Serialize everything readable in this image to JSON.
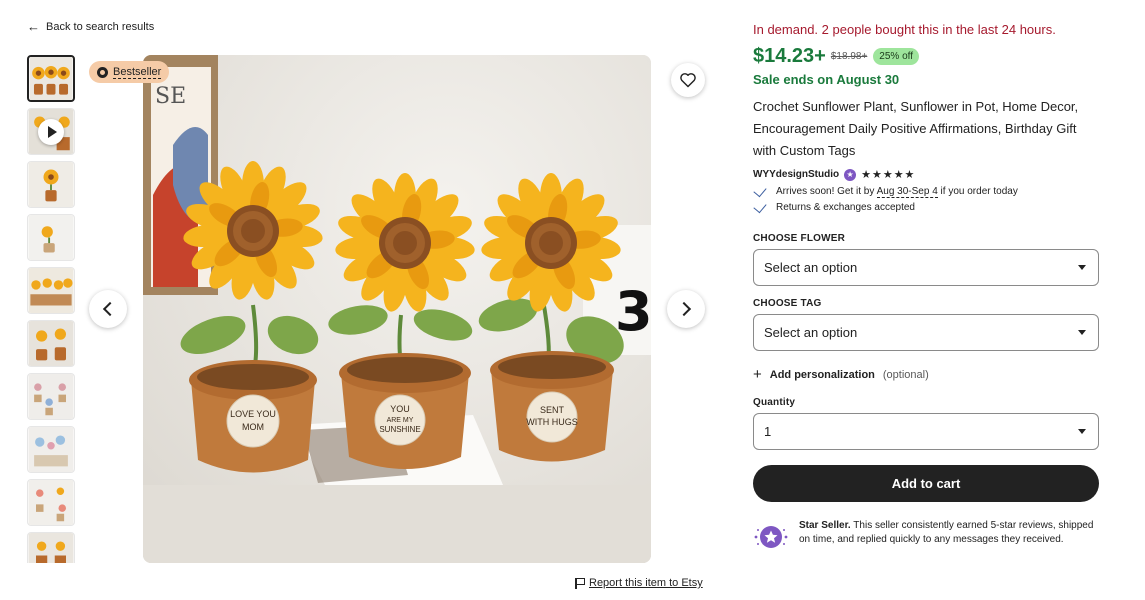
{
  "nav": {
    "back_label": "Back to search results",
    "back_icon": "arrow-left-icon"
  },
  "gallery": {
    "badge_label": "Bestseller",
    "thumb_count": 10,
    "report_label": "Report this item to Etsy"
  },
  "product": {
    "demand_text": "In demand. 2 people bought this in the last 24 hours.",
    "price": "$14.23+",
    "old_price": "$18.98+",
    "discount": "25% off",
    "sale_text": "Sale ends on August 30",
    "title": "Crochet Sunflower Plant, Sunflower in Pot, Home Decor, Encouragement Daily Positive Affirmations, Birthday Gift with Custom Tags",
    "shop_name": "WYYdesignStudio",
    "rating_stars": "★★★★★",
    "rating_value": 5,
    "arrival_prefix": "Arrives soon! Get it by ",
    "arrival_dates": "Aug 30-Sep 4",
    "arrival_suffix": " if you order today",
    "returns": "Returns & exchanges accepted"
  },
  "options": {
    "flower_label": "CHOOSE FLOWER",
    "flower_value": "Select an option",
    "tag_label": "CHOOSE TAG",
    "tag_value": "Select an option",
    "personalization_label": "Add personalization",
    "personalization_optional": "(optional)",
    "quantity_label": "Quantity",
    "quantity_value": "1",
    "add_to_cart": "Add to cart"
  },
  "star_seller": {
    "title": "Star Seller.",
    "text": " This seller consistently earned 5-star reviews, shipped on time, and replied quickly to any messages they received."
  },
  "image_text": {
    "tag1_line1": "LOVE YOU",
    "tag1_line2": "MOM",
    "tag2_line1": "YOU",
    "tag2_line2": "ARE MY",
    "tag2_line3": "SUNSHINE",
    "tag3_line1": "SENT",
    "tag3_line2": "WITH HUGS",
    "calendar_digit": "3",
    "poster_letters": "SE"
  },
  "colors": {
    "demand": "#a61a2e",
    "price": "#1a7a3c",
    "discount_bg": "#9ee59c",
    "badge_bg": "#f5cba7",
    "button": "#222222"
  }
}
